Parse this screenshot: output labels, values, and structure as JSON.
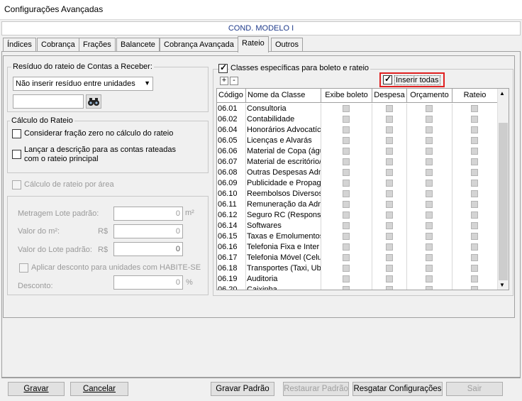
{
  "window": {
    "title": "Configurações Avançadas"
  },
  "condo_name": "COND. MODELO I",
  "tabs": [
    {
      "label": "Índices"
    },
    {
      "label": "Cobrança"
    },
    {
      "label": "Frações"
    },
    {
      "label": "Balancete"
    },
    {
      "label": "Cobrança Avançada"
    },
    {
      "label": "Rateio",
      "active": true
    },
    {
      "label": "Outros"
    }
  ],
  "residuo": {
    "title": "Resíduo do rateio de Contas a Receber:",
    "selected_option": "Não inserir resíduo entre unidades",
    "search_value": ""
  },
  "calculo": {
    "title": "Cálculo do Rateio",
    "opt_fracao_zero": "Considerar fração zero no cálculo do rateio",
    "opt_descricao": "Lançar a descrição para as contas rateadas com o rateio principal"
  },
  "area": {
    "title": "Cálculo de rateio por área",
    "metragem_label": "Metragem Lote padrão:",
    "metragem_value": "0",
    "metragem_unit": "m²",
    "valor_m2_label": "Valor do m²:",
    "valor_m2_currency": "R$",
    "valor_m2_value": "0",
    "valor_lote_label": "Valor do Lote padrão:",
    "valor_lote_currency": "R$",
    "valor_lote_value": "0",
    "habite_se_label": "Aplicar desconto para unidades com HABITE-SE",
    "desconto_label": "Desconto:",
    "desconto_value": "0",
    "desconto_unit": "%"
  },
  "classes": {
    "title": "Classes específicas para boleto e rateio",
    "expand_label": "+",
    "collapse_label": "-",
    "inserir_todas": "Inserir todas",
    "columns": [
      "Código",
      "Nome da Classe",
      "Exibe boleto",
      "Despesa",
      "Orçamento",
      "Rateio"
    ],
    "rows": [
      {
        "code": "06.01",
        "name": "Consultoria"
      },
      {
        "code": "06.02",
        "name": "Contabilidade"
      },
      {
        "code": "06.04",
        "name": "Honorários Advocatíc"
      },
      {
        "code": "06.05",
        "name": "Licenças e Alvarás"
      },
      {
        "code": "06.06",
        "name": "Material de Copa (águ"
      },
      {
        "code": "06.07",
        "name": "Material de escritório/"
      },
      {
        "code": "06.08",
        "name": "Outras Despesas Adm"
      },
      {
        "code": "06.09",
        "name": "Publicidade e Propaga"
      },
      {
        "code": "06.10",
        "name": "Reembolsos Diversos"
      },
      {
        "code": "06.11",
        "name": "Remuneração da Adm"
      },
      {
        "code": "06.12",
        "name": "Seguro RC (Responsa"
      },
      {
        "code": "06.14",
        "name": "Softwares"
      },
      {
        "code": "06.15",
        "name": "Taxas e Emolumentos"
      },
      {
        "code": "06.16",
        "name": "Telefonia Fixa e Inter"
      },
      {
        "code": "06.17",
        "name": "Telefonia Móvel (Celu"
      },
      {
        "code": "06.18",
        "name": "Transportes (Taxi, Ub"
      },
      {
        "code": "06.19",
        "name": "Auditoria"
      },
      {
        "code": "06.20",
        "name": "Caixinha"
      }
    ]
  },
  "buttons": {
    "gravar": "Gravar",
    "cancelar": "Cancelar",
    "gravar_padrao": "Gravar Padrão",
    "restaurar_padrao": "Restaurar Padrão",
    "resgatar": "Resgatar Configurações",
    "sair": "Sair"
  },
  "colors": {
    "highlight": "#e02020",
    "condo_text": "#1e3a8a"
  }
}
